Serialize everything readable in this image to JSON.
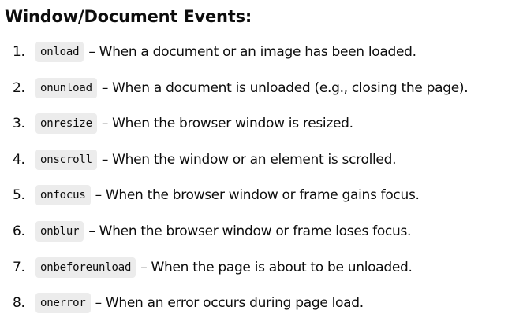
{
  "heading": "Window/Document Events:",
  "events": [
    {
      "number": "1.",
      "code": "onload",
      "description": "– When a document or an image has been loaded."
    },
    {
      "number": "2.",
      "code": "onunload",
      "description": "– When a document is unloaded (e.g., closing the page)."
    },
    {
      "number": "3.",
      "code": "onresize",
      "description": "– When the browser window is resized."
    },
    {
      "number": "4.",
      "code": "onscroll",
      "description": "– When the window or an element is scrolled."
    },
    {
      "number": "5.",
      "code": "onfocus",
      "description": "– When the browser window or frame gains focus."
    },
    {
      "number": "6.",
      "code": "onblur",
      "description": "– When the browser window or frame loses focus."
    },
    {
      "number": "7.",
      "code": "onbeforeunload",
      "description": "– When the page is about to be unloaded."
    },
    {
      "number": "8.",
      "code": "onerror",
      "description": "– When an error occurs during page load."
    }
  ]
}
